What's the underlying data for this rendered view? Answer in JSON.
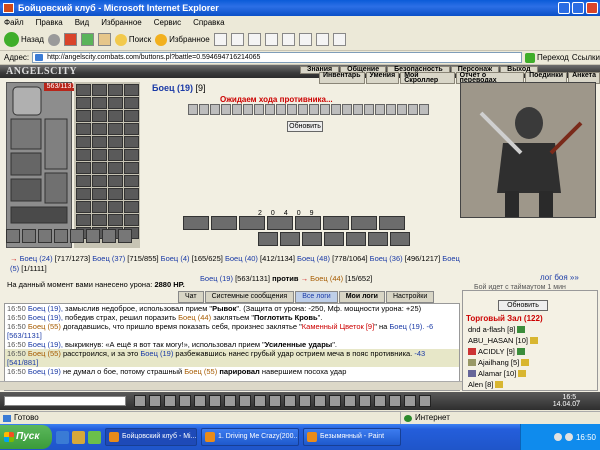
{
  "window": {
    "title": "Бойцовский клуб - Microsoft Internet Explorer"
  },
  "menu": [
    "Файл",
    "Правка",
    "Вид",
    "Избранное",
    "Сервис",
    "Справка"
  ],
  "toolbar": {
    "back": "Назад",
    "search": "Поиск",
    "favorites": "Избранное"
  },
  "address": {
    "label": "Адрес:",
    "url": "http://angelscity.combats.com/buttons.pl?battle=0.594694716214065",
    "go": "Переход",
    "links": "Ссылки"
  },
  "game": {
    "logo": "ANGELSCITY",
    "nav_top": [
      "Знания",
      "Общение",
      "Безопасность",
      "Персонаж",
      "Выход"
    ],
    "nav_bottom": [
      "Инвентарь",
      "Умения",
      "Мой Скроллер",
      "Отчёт о переводах",
      "Поединки",
      "Анкета"
    ],
    "hp": "563/1131",
    "enemy": {
      "name": "Боец (19)",
      "level": "[9]"
    },
    "wait_text": "Ожидаем хода противника...",
    "refresh": "Обновить",
    "counts": [
      "2",
      "0",
      "4",
      "0",
      "9"
    ],
    "fighters_line1": [
      "Боец (24)",
      "[717/1273]",
      "Боец (37)",
      "[715/855]",
      "Боец (4)",
      "[165/625]",
      "Боец (40)",
      "[412/1134]",
      "Боец (48)",
      "[778/1064]",
      "Боец (36)",
      "[496/1217]",
      "Боец (5)",
      "[1/1111]"
    ],
    "fighters_line2": [
      "Боец (19)",
      "[563/1131]",
      "против",
      "Боец (44)",
      "[15/652]"
    ],
    "log_link": "лог боя »»",
    "clip": "Бой идет с таймаутом 1 мин",
    "damage": {
      "label": "На данный момент вами нанесено урона:",
      "value": "2880 HP."
    }
  },
  "tabs": [
    "Чат",
    "Системные сообщения",
    "Все логи",
    "Мои логи",
    "Настройки"
  ],
  "chat": [
    {
      "time": "16:50",
      "text1": "Боец (19),",
      "text2": " замыслив недоброе, использовал прием \"",
      "b": "Рывок",
      "text3": "\". (Защита от урона: -250, Мф. мощности урона: +25)"
    },
    {
      "time": "16:50",
      "text1": "Боец (19),",
      "text2": " победив страх, решил поразить ",
      "brown": "Боец (44)",
      "text3": " заклятьем \"",
      "b": "Поглотить Кровь",
      "text4": "\"."
    },
    {
      "time": "16:50",
      "text1": "Боец (55)",
      "text2": " догадавшись, что пришло время показать себя, произнес заклятье \"",
      "red": "Каменный Цветок [9]",
      "text3": "\" на ",
      "text1b": "Боец (19).",
      "dmg": " -6 [563/1131]"
    },
    {
      "time": "16:50",
      "text1": "Боец (19),",
      "text2": " выкрикнув: «А ещё я вот так могу!», использовал прием \"",
      "b": "Усиленные удары",
      "text3": "\"."
    },
    {
      "time": "16:50",
      "text1": "Боец (55)",
      "text2": " расстроился, и за это ",
      "text1b": "Боец (19)",
      "text3": " разбежавшись нанес грубый удар острием меча в пояс противника.",
      "dmg": " -43 [541/881]"
    },
    {
      "time": "16:50",
      "text1": "Боец (19)",
      "text2": " не думал о бое, потому страшный ",
      "brown": "Боец (55)",
      "b": " парировал",
      "text3": " навершием посоха удар"
    }
  ],
  "right_panel": {
    "refresh": "Обновить",
    "room": "Торговый Зал (122)",
    "users": [
      {
        "name": "dnd a-flash",
        "lvl": "[8]",
        "color": "dark"
      },
      {
        "name": "ABU_HASAN",
        "lvl": "[10]",
        "color": "dark"
      },
      {
        "name": "ACIDLY",
        "lvl": "[9]",
        "color": "dark"
      },
      {
        "name": "Ajailhang",
        "lvl": "[5]",
        "color": "dark"
      },
      {
        "name": "Alamar",
        "lvl": "[10]",
        "color": "dark"
      },
      {
        "name": "Alen",
        "lvl": "[8]",
        "color": "dark"
      }
    ]
  },
  "clock": {
    "time": "16:5_",
    "date": "14.04.07"
  },
  "status": {
    "left": "Готово",
    "right": "Интернет"
  },
  "taskbar": {
    "start": "Пуск",
    "items": [
      "Бойцовский клуб - Mi...",
      "1. Driving Me Crazy(200...",
      "Безымянный - Paint"
    ],
    "time": "16:50"
  },
  "colors": {
    "title_blue": "#0a5bd8",
    "link_blue": "#1a3aa6",
    "red": "#c00000",
    "brown": "#a65b00"
  }
}
